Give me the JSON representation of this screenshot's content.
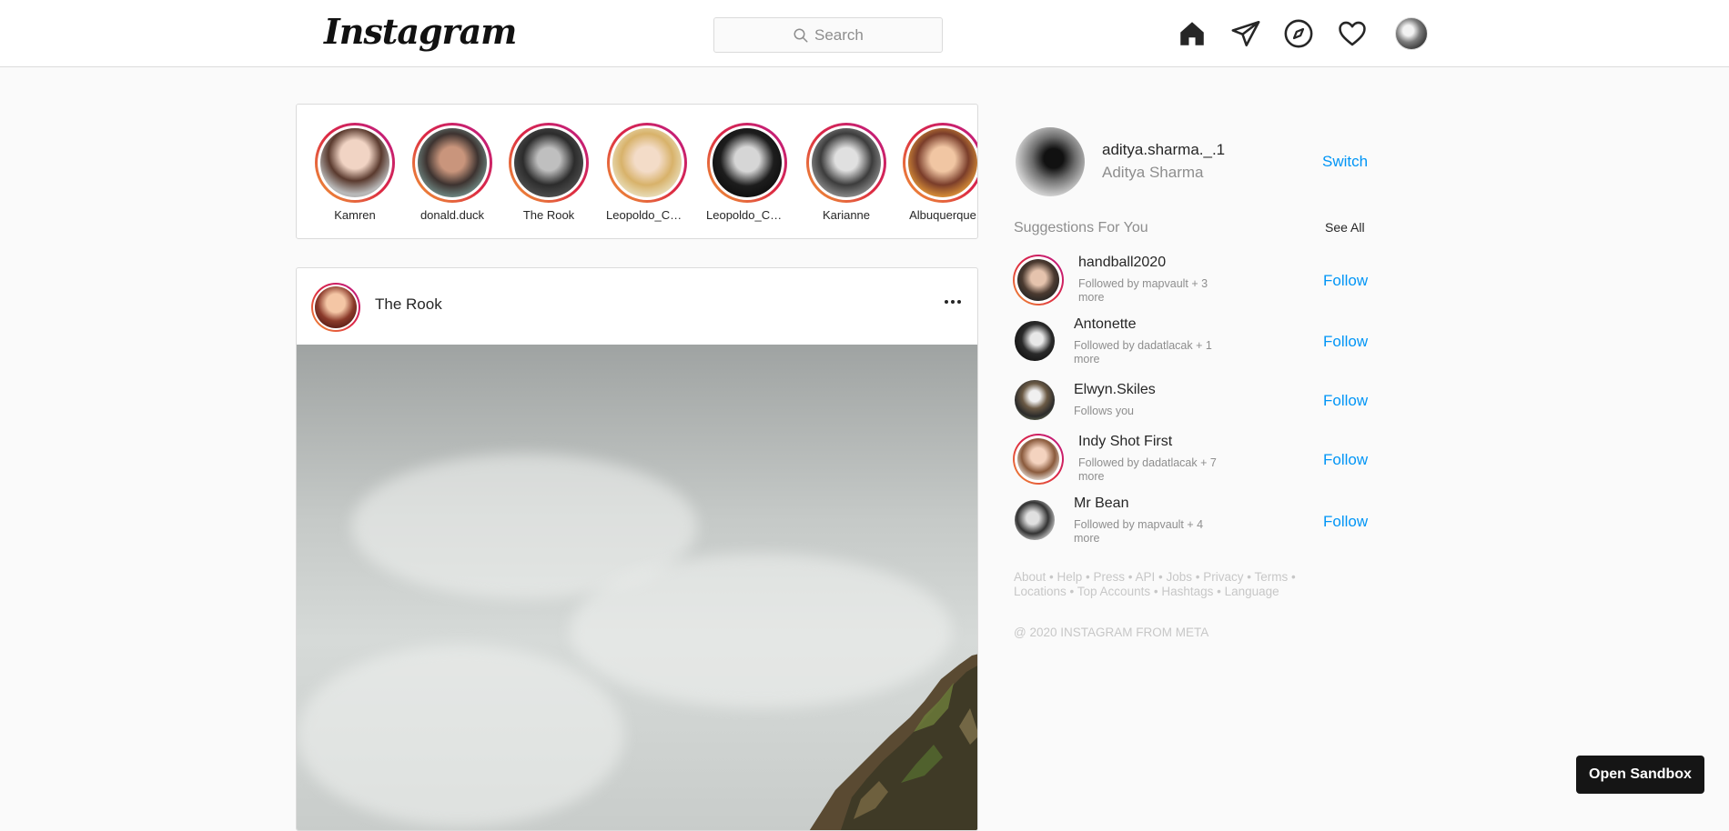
{
  "header": {
    "logo": "Instagram",
    "search_placeholder": "Search",
    "icons": [
      "home-icon",
      "direct-icon",
      "explore-icon",
      "activity-icon",
      "profile-avatar"
    ]
  },
  "stories": [
    {
      "name": "Kamren"
    },
    {
      "name": "donald.duck"
    },
    {
      "name": "The Rook"
    },
    {
      "name": "Leopoldo_Corkery"
    },
    {
      "name": "Leopoldo_Corkery"
    },
    {
      "name": "Karianne"
    },
    {
      "name": "Albuquerque"
    }
  ],
  "post": {
    "username": "The Rook"
  },
  "sidebar": {
    "username": "aditya.sharma._.1",
    "full_name": "Aditya Sharma",
    "switch_label": "Switch",
    "suggestions_title": "Suggestions For You",
    "see_all_label": "See All",
    "suggestions": [
      {
        "name": "handball2020",
        "subtitle": "Followed by mapvault + 3 more",
        "action": "Follow"
      },
      {
        "name": "Antonette",
        "subtitle": "Followed by dadatlacak + 1 more",
        "action": "Follow"
      },
      {
        "name": "Elwyn.Skiles",
        "subtitle": "Follows you",
        "action": "Follow"
      },
      {
        "name": "Indy Shot First",
        "subtitle": "Followed by dadatlacak + 7 more",
        "action": "Follow"
      },
      {
        "name": "Mr Bean",
        "subtitle": "Followed by mapvault + 4 more",
        "action": "Follow"
      }
    ],
    "footer_links": [
      "About",
      "Help",
      "Press",
      "API",
      "Jobs",
      "Privacy",
      "Terms",
      "Locations",
      "Top Accounts",
      "Hashtags",
      "Language"
    ],
    "copyright": "@ 2020 INSTAGRAM FROM META"
  },
  "sandbox_button": "Open Sandbox",
  "colors": {
    "link_blue": "#0095f6",
    "border": "#dbdbdb",
    "background": "#fafafa"
  }
}
